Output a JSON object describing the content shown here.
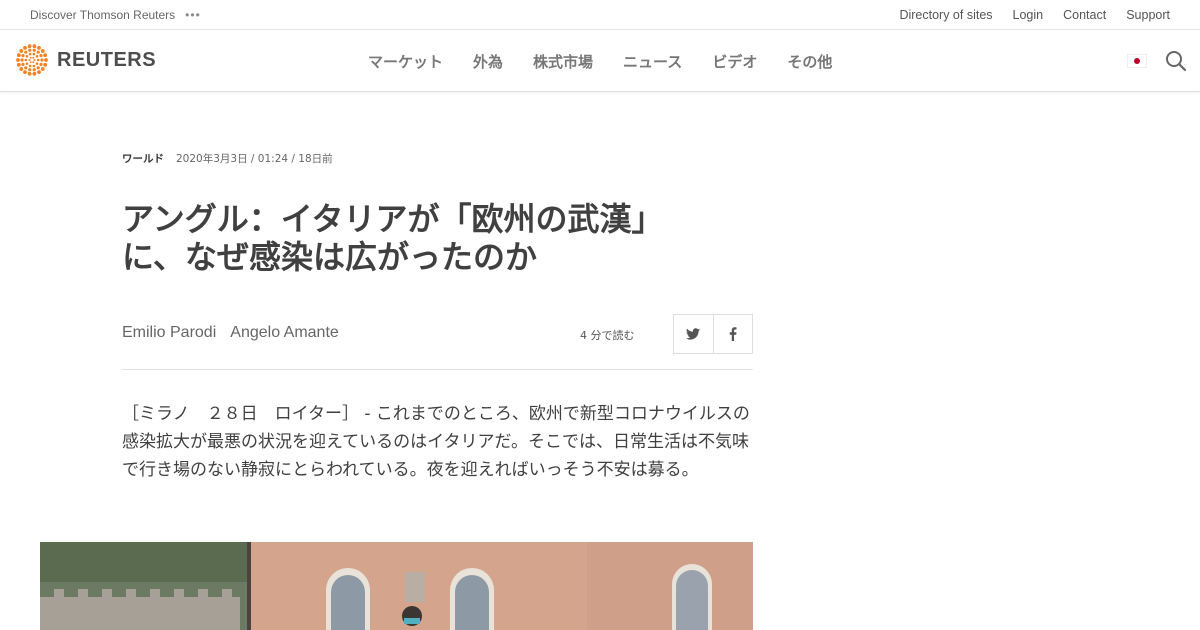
{
  "util_bar": {
    "discover": "Discover Thomson Reuters",
    "more": "•••",
    "links": [
      "Directory of sites",
      "Login",
      "Contact",
      "Support"
    ]
  },
  "header": {
    "logo_text": "REUTERS",
    "nav": [
      "マーケット",
      "外為",
      "株式市場",
      "ニュース",
      "ビデオ",
      "その他"
    ]
  },
  "article": {
    "category": "ワールド",
    "date": "2020年3月3日 / 01:24 / 18日前",
    "title_line1": "アングル：イタリアが「欧州の武漢」",
    "title_line2": "に、なぜ感染は広がったのか",
    "authors": [
      "Emilio Parodi",
      "Angelo Amante"
    ],
    "read_time": "4 分で読む",
    "body": "［ミラノ　２８日　ロイター］ - これまでのところ、欧州で新型コロナウイルスの感染拡大が最悪の状況を迎えているのはイタリアだ。そこでは、日常生活は不気味で行き場のない静寂にとらわれている。夜を迎えればいっそう不安は募る。"
  },
  "colors": {
    "logo_orange": "#f58220",
    "flag_red": "#bc002d",
    "text": "#404040"
  },
  "icons": {
    "share": [
      "twitter-icon",
      "facebook-icon"
    ],
    "search": "search-icon"
  }
}
